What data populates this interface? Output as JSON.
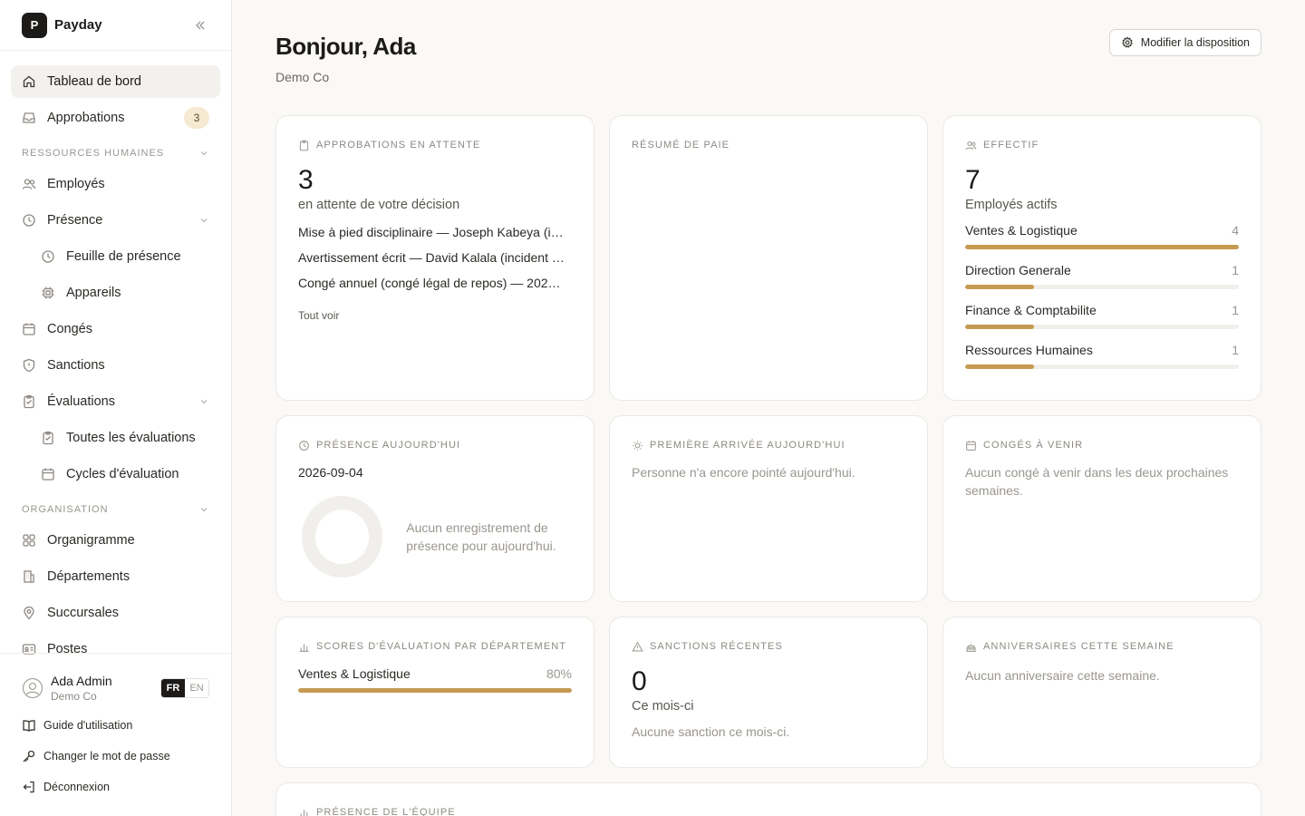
{
  "brand": {
    "logo_letter": "P",
    "name": "Payday"
  },
  "nav": {
    "dashboard": "Tableau de bord",
    "approvals": "Approbations",
    "approvals_badge": "3",
    "section_hr": "RESSOURCES HUMAINES",
    "employees": "Employés",
    "presence": "Présence",
    "timesheet": "Feuille de présence",
    "devices": "Appareils",
    "leave": "Congés",
    "sanctions": "Sanctions",
    "evaluations": "Évaluations",
    "all_evaluations": "Toutes les évaluations",
    "evaluation_cycles": "Cycles d'évaluation",
    "section_org": "ORGANISATION",
    "org_chart": "Organigramme",
    "departments": "Départements",
    "branches": "Succursales",
    "positions": "Postes"
  },
  "footer": {
    "user_name": "Ada Admin",
    "user_org": "Demo Co",
    "lang_fr": "FR",
    "lang_en": "EN",
    "guide": "Guide d'utilisation",
    "change_password": "Changer le mot de passe",
    "logout": "Déconnexion"
  },
  "header": {
    "greeting": "Bonjour, Ada",
    "company": "Demo Co",
    "layout_button": "Modifier la disposition"
  },
  "cards": {
    "pending": {
      "title": "APPROBATIONS EN ATTENTE",
      "count": "3",
      "subtitle": "en attente de votre décision",
      "items": [
        "Mise à pied disciplinaire — Joseph Kabeya (i…",
        "Avertissement écrit — David Kalala (incident …",
        "Congé annuel (congé légal de repos) — 202…"
      ],
      "view_all": "Tout voir"
    },
    "payroll": {
      "title": "RÉSUMÉ DE PAIE"
    },
    "headcount": {
      "title": "EFFECTIF",
      "count": "7",
      "subtitle": "Employés actifs",
      "departments": [
        {
          "name": "Ventes & Logistique",
          "value": "4",
          "fraction": 1.0
        },
        {
          "name": "Direction Generale",
          "value": "1",
          "fraction": 0.25
        },
        {
          "name": "Finance & Comptabilite",
          "value": "1",
          "fraction": 0.25
        },
        {
          "name": "Ressources Humaines",
          "value": "1",
          "fraction": 0.25
        }
      ]
    },
    "presence_today": {
      "title": "PRÉSENCE AUJOURD'HUI",
      "date": "2026-09-04",
      "empty": "Aucun enregistrement de présence pour aujourd'hui."
    },
    "first_arrival": {
      "title": "PREMIÈRE ARRIVÉE AUJOURD'HUI",
      "empty": "Personne n'a encore pointé aujourd'hui."
    },
    "upcoming_leave": {
      "title": "CONGÉS À VENIR",
      "empty": "Aucun congé à venir dans les deux prochaines semaines."
    },
    "eval_scores": {
      "title": "SCORES D'ÉVALUATION PAR DÉPARTEMENT",
      "rows": [
        {
          "name": "Ventes & Logistique",
          "value": "80%",
          "fraction": 1.0
        }
      ]
    },
    "recent_sanctions": {
      "title": "SANCTIONS RÉCENTES",
      "count": "0",
      "subtitle": "Ce mois-ci",
      "empty": "Aucune sanction ce mois-ci."
    },
    "birthdays": {
      "title": "ANNIVERSAIRES CETTE SEMAINE",
      "empty": "Aucun anniversaire cette semaine."
    },
    "team_presence": {
      "title": "PRÉSENCE DE L'ÉQUIPE"
    }
  },
  "colors": {
    "accent": "#c59a52",
    "badge_bg": "#f6ead2",
    "dark": "#1c1b19"
  }
}
